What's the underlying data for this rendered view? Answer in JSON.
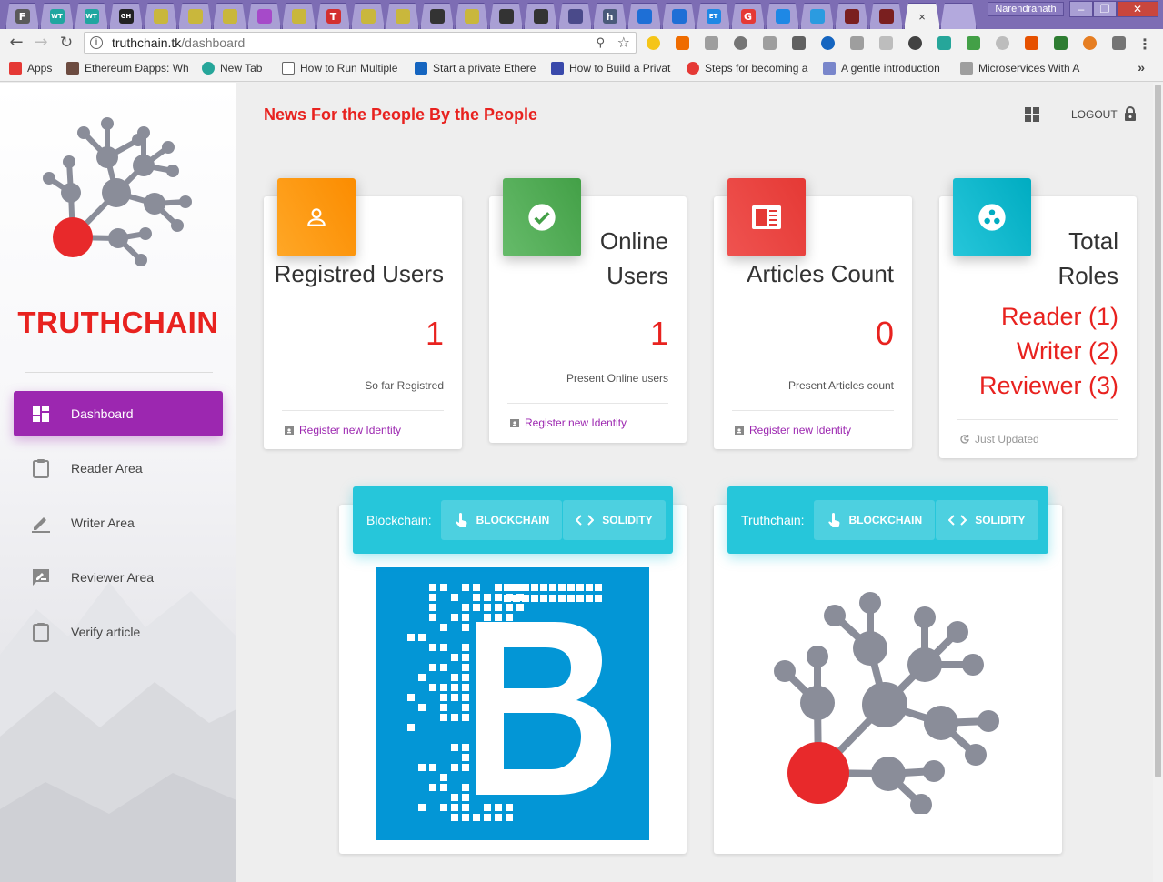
{
  "browser": {
    "tab_favicons": [
      "F",
      "WT",
      "WT",
      "GH",
      "",
      "",
      "",
      "",
      "",
      "T",
      "",
      "",
      "",
      "",
      "",
      "",
      "",
      "h",
      "",
      "",
      "ETH",
      "G",
      "",
      "",
      "",
      "",
      ""
    ],
    "active_tab_close": "×",
    "window_user": "Narendranath",
    "url_host": "truthchain.tk",
    "url_path": "/dashboard",
    "bookmarks": [
      {
        "label": "Apps"
      },
      {
        "label": "Ethereum Ðapps: Wh"
      },
      {
        "label": "New Tab"
      },
      {
        "label": "How to Run Multiple"
      },
      {
        "label": "Start a private Ethere"
      },
      {
        "label": "How to Build a Privat"
      },
      {
        "label": "Steps for becoming a"
      },
      {
        "label": "A gentle introduction"
      },
      {
        "label": "Microservices With A"
      }
    ],
    "bookmarks_more": "»"
  },
  "sidebar": {
    "brand": "TRUTHCHAIN",
    "items": [
      {
        "label": "Dashboard",
        "icon": "dashboard-icon",
        "active": true
      },
      {
        "label": "Reader Area",
        "icon": "clipboard-icon"
      },
      {
        "label": "Writer Area",
        "icon": "pencil-icon"
      },
      {
        "label": "Reviewer Area",
        "icon": "rate-review-icon"
      },
      {
        "label": "Verify article",
        "icon": "clipboard-icon"
      }
    ]
  },
  "header": {
    "title": "News For the People By the People",
    "logout": "LOGOUT"
  },
  "stats": [
    {
      "title": "Registred Users",
      "value": "1",
      "caption": "So far Registred",
      "footer": "Register new Identity",
      "color": "#fb8c00"
    },
    {
      "title": "Online Users",
      "value": "1",
      "caption": "Present Online users",
      "footer": "Register new Identity",
      "color": "#43a047"
    },
    {
      "title": "Articles Count",
      "value": "0",
      "caption": "Present Articles count",
      "footer": "Register new Identity",
      "color": "#e53935"
    },
    {
      "title": "Total Roles",
      "roles": [
        "Reader (1)",
        "Writer (2)",
        "Reviewer (3)"
      ],
      "footer": "Just Updated",
      "color": "#00acc1"
    }
  ],
  "features": [
    {
      "label": "Blockchain:",
      "tabs": [
        "BLOCKCHAIN",
        "SOLIDITY"
      ]
    },
    {
      "label": "Truthchain:",
      "tabs": [
        "BLOCKCHAIN",
        "SOLIDITY"
      ]
    }
  ],
  "colors": {
    "brand_red": "#e8221f",
    "accent_purple": "#9c27b0",
    "cyan": "#26c6da",
    "logo_grey": "#8a8d99"
  }
}
